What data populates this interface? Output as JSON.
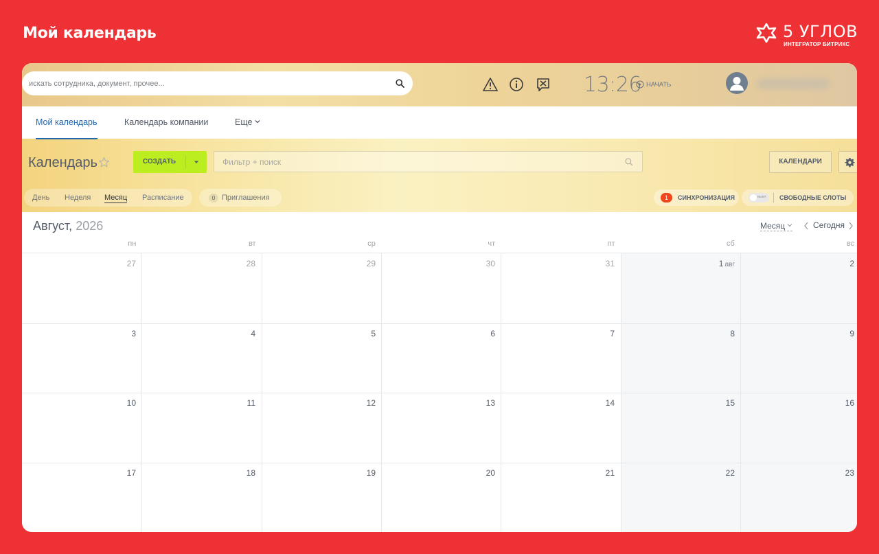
{
  "page_title": "Мой календарь",
  "brand": {
    "name": "5 УГЛОВ",
    "tagline": "ИНТЕГРАТОР БИТРИКС"
  },
  "header": {
    "search_placeholder": "искать сотрудника, документ, прочее...",
    "time": "13:26",
    "start_label": "НАЧАТЬ",
    "icons": [
      "warning-icon",
      "info-icon",
      "tools-chat-icon",
      "search-icon",
      "play-icon",
      "user-avatar-icon"
    ]
  },
  "tabs": [
    {
      "label": "Мой календарь",
      "active": true
    },
    {
      "label": "Календарь компании",
      "active": false
    },
    {
      "label": "Еще",
      "active": false
    }
  ],
  "toolbar": {
    "title": "Календарь",
    "create_label": "СОЗДАТЬ",
    "filter_placeholder": "Фильтр + поиск",
    "calendars_label": "КАЛЕНДАРИ"
  },
  "views": [
    {
      "label": "День",
      "active": false
    },
    {
      "label": "Неделя",
      "active": false
    },
    {
      "label": "Месяц",
      "active": true
    },
    {
      "label": "Расписание",
      "active": false
    }
  ],
  "invitations": {
    "count": "0",
    "label": "Приглашения"
  },
  "sync": {
    "count": "1",
    "label": "СИНХРОНИЗАЦИЯ"
  },
  "free_slots": {
    "toggle_label": "выкл",
    "label": "СВОБОДНЫЕ СЛОТЫ"
  },
  "calendar": {
    "month": "Август,",
    "year": "2026",
    "mode_label": "Месяц",
    "today_label": "Сегодня",
    "weekdays": [
      "пн",
      "вт",
      "ср",
      "чт",
      "пт",
      "сб",
      "вс"
    ],
    "weeks": [
      [
        {
          "day": "27",
          "other": true
        },
        {
          "day": "28",
          "other": true
        },
        {
          "day": "29",
          "other": true
        },
        {
          "day": "30",
          "other": true
        },
        {
          "day": "31",
          "other": true
        },
        {
          "day": "1",
          "suffix": "авг"
        },
        {
          "day": "2"
        }
      ],
      [
        {
          "day": "3"
        },
        {
          "day": "4"
        },
        {
          "day": "5"
        },
        {
          "day": "6"
        },
        {
          "day": "7"
        },
        {
          "day": "8"
        },
        {
          "day": "9"
        }
      ],
      [
        {
          "day": "10"
        },
        {
          "day": "11"
        },
        {
          "day": "12"
        },
        {
          "day": "13"
        },
        {
          "day": "14"
        },
        {
          "day": "15"
        },
        {
          "day": "16"
        }
      ],
      [
        {
          "day": "17"
        },
        {
          "day": "18"
        },
        {
          "day": "19"
        },
        {
          "day": "20"
        },
        {
          "day": "21"
        },
        {
          "day": "22"
        },
        {
          "day": "23"
        }
      ]
    ]
  },
  "colors": {
    "frame": "#ee3134",
    "accent_blue": "#2067b0",
    "create_button": "#bbed21",
    "sync_badge": "#f0451d",
    "weekend_bg": "#f5f7f8"
  }
}
